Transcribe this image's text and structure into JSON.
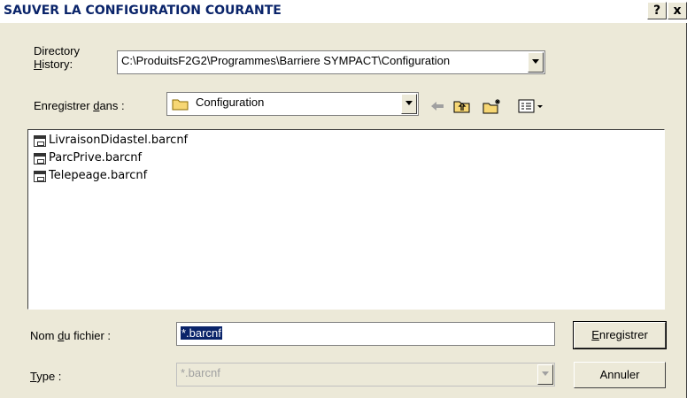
{
  "dialog": {
    "title": "SAUVER LA CONFIGURATION COURANTE",
    "help_label": "?",
    "close_label": "x"
  },
  "history": {
    "label_line1": "Directory",
    "label_line2": "History:",
    "value": "C:\\ProduitsF2G2\\Programmes\\Barriere SYMPACT\\Configuration"
  },
  "save_in": {
    "label": "Enregistrer dans :",
    "value": "Configuration"
  },
  "files": [
    "LivraisonDidastel.barcnf",
    "ParcPrive.barcnf",
    "Telepeage.barcnf"
  ],
  "filename": {
    "label": "Nom du fichier :",
    "value": "*.barcnf"
  },
  "type": {
    "label": "Type :",
    "value": "*.barcnf"
  },
  "buttons": {
    "save": "Enregistrer",
    "cancel": "Annuler"
  }
}
